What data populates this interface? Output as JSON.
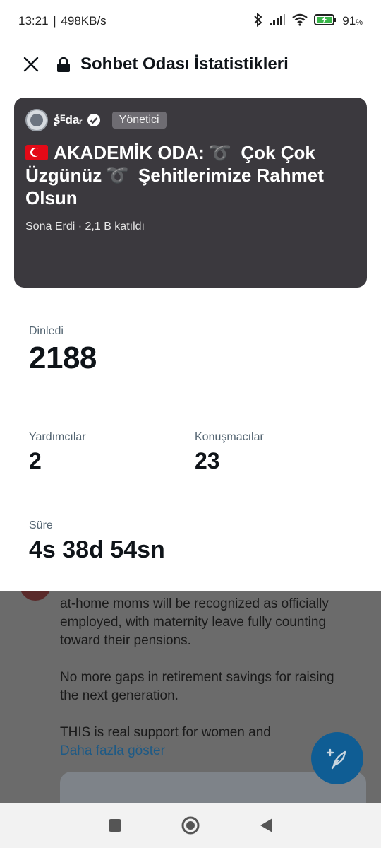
{
  "status_bar": {
    "time": "13:21",
    "network_speed": "498KB/s",
    "battery_percent": "91",
    "battery_suffix": "%"
  },
  "header": {
    "title": "Sohbet Odası İstatistikleri"
  },
  "space_card": {
    "host_name": "ʂ̽ᴱdaᵣ",
    "role_badge": "Yönetici",
    "title_part1": "AKADEMİK ODA:",
    "title_ribbon": "➰",
    "title_part2": "Çok Çok Üzgünüz",
    "title_part3": "Şehitlerimize Rahmet Olsun",
    "status": "Sona Erdi",
    "separator": "·",
    "participants": "2,1 B katıldı",
    "background_color": "#3b393e"
  },
  "stats": {
    "listened_label": "Dinledi",
    "listened_value": "2188",
    "cohosts_label": "Yardımcılar",
    "cohosts_value": "2",
    "speakers_label": "Konuşmacılar",
    "speakers_value": "23",
    "duration_label": "Süre",
    "duration_value": "4s 38d 54sn"
  },
  "background_post": {
    "line1": "at-home moms will be recognized as officially employed, with maternity leave fully counting toward their pensions.",
    "line2": "No more gaps in retirement savings for raising the next generation.",
    "line3": "THIS is real support for women and",
    "show_more": "Daha fazla göster"
  },
  "icons": {
    "close": "close-icon",
    "lock": "lock-icon",
    "verified": "verified-badge-icon",
    "compose": "compose-feather-icon",
    "nav_recent": "square-icon",
    "nav_home": "circle-icon",
    "nav_back": "triangle-back-icon"
  }
}
